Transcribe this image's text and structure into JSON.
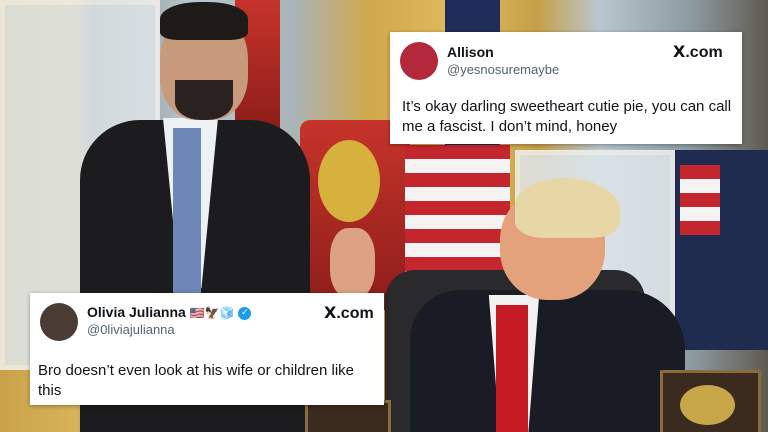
{
  "tweet_top": {
    "name": "Allison",
    "handle": "@yesnosuremaybe",
    "text": "It’s okay darling sweetheart cutie pie, you can call me a fascist. I don’t mind, honey",
    "source_x": "X",
    "source_domain": ".com",
    "avatar_color": "#b3283a"
  },
  "tweet_bottom": {
    "name": "Olivia Julianna",
    "name_emojis": "🇺🇸🦅🧊",
    "verified_icon": "verified-badge-icon",
    "handle": "@0liviajulianna",
    "text": "Bro doesn’t even look at his wife or children like this",
    "source_x": "X",
    "source_domain": ".com",
    "avatar_color": "#4a3b35",
    "verified_color": "#1d9bf0"
  }
}
